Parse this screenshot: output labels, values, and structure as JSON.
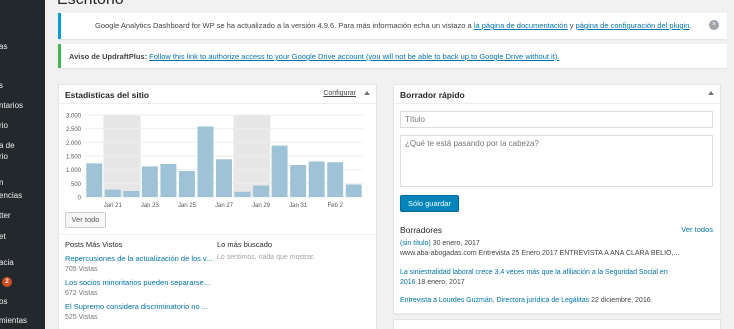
{
  "page_title": "Escritorio",
  "sidebar": {
    "items": [
      {
        "label": "as"
      },
      {
        "label": "s"
      },
      {
        "label": "ntarios"
      },
      {
        "label": "rio"
      },
      {
        "label": "a de"
      },
      {
        "label": "rio"
      },
      {
        "label": "n"
      },
      {
        "label": "encias"
      },
      {
        "label": "tter"
      },
      {
        "label": "et"
      },
      {
        "label": "acia"
      },
      {
        "label": "2"
      },
      {
        "label": "os"
      },
      {
        "label": "mientas"
      }
    ]
  },
  "notices": {
    "ga": {
      "text_before": "Google Analytics Dashboard for WP se ha actualizado a la versión 4.9.6. Para más información echa un vistazo a ",
      "link1": "la página de documentación",
      "text_mid": " y ",
      "link2": "página de configuración del plugin",
      "text_after": ".",
      "close": "×"
    },
    "updraft": {
      "label": "Aviso de UpdraftPlus:",
      "link": "Follow this link to authorize access to your Google Drive account (you will not be able to back up to Google Drive without it)."
    }
  },
  "stats_box": {
    "title": "Estadísticas del sitio",
    "configure": "Configurar",
    "view_all": "Ver todo",
    "col_most_viewed": "Posts Más Vistos",
    "col_most_searched": "Lo más buscado",
    "empty_search": "Lo sentimos, nada que mostrar.",
    "posts": [
      {
        "title": "Repercusiones de la actualización de los v...",
        "views": "705 Vistas"
      },
      {
        "title": "Los socios minoritarios pueden separarse...",
        "views": "672 Vistas"
      },
      {
        "title": "El Supremo considera discriminatorio no ...",
        "views": "525 Vistas"
      }
    ]
  },
  "chart_data": {
    "type": "bar",
    "title": "",
    "ylim": [
      0,
      3000
    ],
    "yticks": [
      "3.000",
      "2.500",
      "2.000",
      "1.500",
      "1.000",
      "500",
      "0"
    ],
    "xticks": [
      "Jan 21",
      "Jan 23",
      "Jan 25",
      "Jan 27",
      "Jan 29",
      "Jan 31",
      "Feb 2"
    ],
    "values": [
      1230,
      270,
      220,
      1120,
      1210,
      950,
      2580,
      1380,
      190,
      420,
      1880,
      1170,
      1300,
      1270,
      460
    ],
    "weekend_bands": [
      [
        1,
        2
      ],
      [
        8,
        9
      ]
    ],
    "colors": {
      "bar": "#9ec2d6",
      "band": "#e7e7e7",
      "grid": "#eeeeee"
    }
  },
  "quick_draft": {
    "title": "Borrador rápido",
    "title_placeholder": "Título",
    "body_placeholder": "¿Qué te está pasando por la cabeza?",
    "save_button": "Sólo guardar",
    "drafts_label": "Borradores",
    "view_all": "Ver todos",
    "drafts": [
      {
        "link": "(sin título)",
        "date": "30 enero, 2017",
        "excerpt": "www.aba-abogadas.com Entrevista 25 Enero 2017 ENTREVISTA A ANA CLARA BELIO,..."
      },
      {
        "link": "La siniestralidad laboral crece 3.4 veces más que la afiliación a la Seguridad Social en",
        "link2": "2016",
        "date": "18 enero, 2017"
      },
      {
        "link": "Entrevista a Lourdes Guzmán, Directora jurídica de Legálitas",
        "date": "22 diciembre, 2016"
      }
    ]
  }
}
